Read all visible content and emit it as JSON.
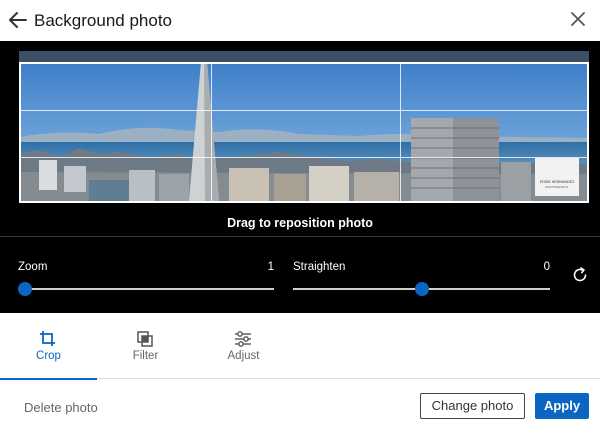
{
  "header": {
    "title": "Background photo",
    "back_icon": "arrow-left-icon",
    "close_icon": "close-icon"
  },
  "editor": {
    "drag_hint": "Drag to reposition photo",
    "watermark_line1": "EDDIE HERNANDEZ",
    "watermark_line2": "PHOTOGRAPHY",
    "zoom": {
      "label": "Zoom",
      "value": "1",
      "level": 0.0
    },
    "straighten": {
      "label": "Straighten",
      "value": "0",
      "level": 0.5
    },
    "reset_icon": "rotate-reset-icon"
  },
  "tabs": [
    {
      "label": "Crop",
      "icon": "crop-icon",
      "active": true
    },
    {
      "label": "Filter",
      "icon": "filter-icon",
      "active": false
    },
    {
      "label": "Adjust",
      "icon": "adjust-sliders-icon",
      "active": false
    }
  ],
  "footer": {
    "delete_label": "Delete photo",
    "change_label": "Change photo",
    "apply_label": "Apply"
  },
  "colors": {
    "accent": "#0a66c2",
    "editor_bg": "#000000"
  }
}
